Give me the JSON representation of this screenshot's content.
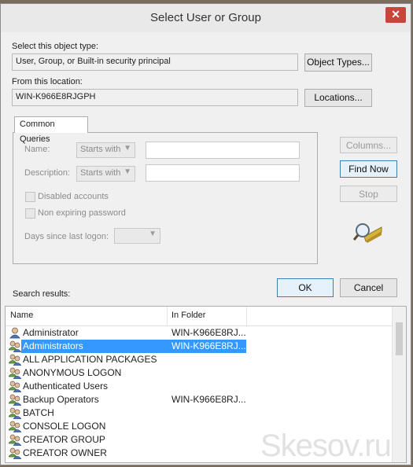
{
  "window": {
    "title": "Select User or Group",
    "close_glyph": "✕"
  },
  "object_type": {
    "label": "Select this object type:",
    "value": "User, Group, or Built-in security principal",
    "button": "Object Types..."
  },
  "location": {
    "label": "From this location:",
    "value": "WIN-K966E8RJGPH",
    "button": "Locations..."
  },
  "common_queries": {
    "tab_label": "Common Queries",
    "name_label": "Name:",
    "name_combo": "Starts with",
    "description_label": "Description:",
    "description_combo": "Starts with",
    "disabled_accounts": "Disabled accounts",
    "non_expiring_password": "Non expiring password",
    "days_since_logon": "Days since last logon:"
  },
  "side_buttons": {
    "columns": "Columns...",
    "find_now": "Find Now",
    "stop": "Stop"
  },
  "dialog_buttons": {
    "ok": "OK",
    "cancel": "Cancel"
  },
  "results": {
    "label": "Search results:",
    "columns": [
      "Name",
      "In Folder"
    ],
    "rows": [
      {
        "name": "Administrator",
        "folder": "WIN-K966E8RJ...",
        "icon": "user-icon"
      },
      {
        "name": "Administrators",
        "folder": "WIN-K966E8RJ...",
        "icon": "group-icon",
        "selected": true
      },
      {
        "name": "ALL APPLICATION PACKAGES",
        "folder": "",
        "icon": "group-icon"
      },
      {
        "name": "ANONYMOUS LOGON",
        "folder": "",
        "icon": "group-icon"
      },
      {
        "name": "Authenticated Users",
        "folder": "",
        "icon": "group-icon"
      },
      {
        "name": "Backup Operators",
        "folder": "WIN-K966E8RJ...",
        "icon": "group-icon"
      },
      {
        "name": "BATCH",
        "folder": "",
        "icon": "group-icon"
      },
      {
        "name": "CONSOLE LOGON",
        "folder": "",
        "icon": "group-icon"
      },
      {
        "name": "CREATOR GROUP",
        "folder": "",
        "icon": "group-icon"
      },
      {
        "name": "CREATOR OWNER",
        "folder": "",
        "icon": "group-icon"
      }
    ]
  },
  "watermark": "Skesov.ru",
  "colors": {
    "selection": "#3399ff",
    "primary_border": "#3c7fb1",
    "close_button": "#c7463c"
  }
}
